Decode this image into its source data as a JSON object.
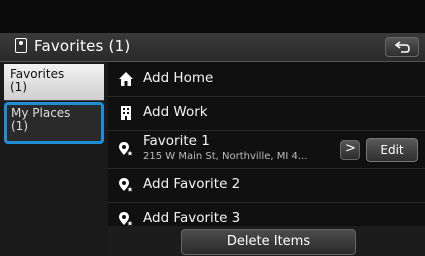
{
  "header": {
    "title": "Favorites (1)",
    "back_icon": "back-arrow-icon"
  },
  "sidebar": {
    "items": [
      {
        "label": "Favorites",
        "count": "(1)"
      },
      {
        "label": "My Places",
        "count": "(1)"
      }
    ]
  },
  "list": {
    "rows": [
      {
        "label": "Add Home",
        "icon": "home-icon"
      },
      {
        "label": "Add Work",
        "icon": "building-icon"
      },
      {
        "label": "Favorite 1",
        "address": "215 W Main St, Northville, MI 4...",
        "icon": "favorite-pin-icon",
        "chevron": ">",
        "edit_label": "Edit"
      },
      {
        "label": "Add Favorite 2",
        "icon": "favorite-pin-icon"
      },
      {
        "label": "Add Favorite 3",
        "icon": "favorite-pin-icon"
      }
    ]
  },
  "footer": {
    "delete_label": "Delete Items"
  },
  "colors": {
    "selection_outline": "#1f8ed6"
  }
}
